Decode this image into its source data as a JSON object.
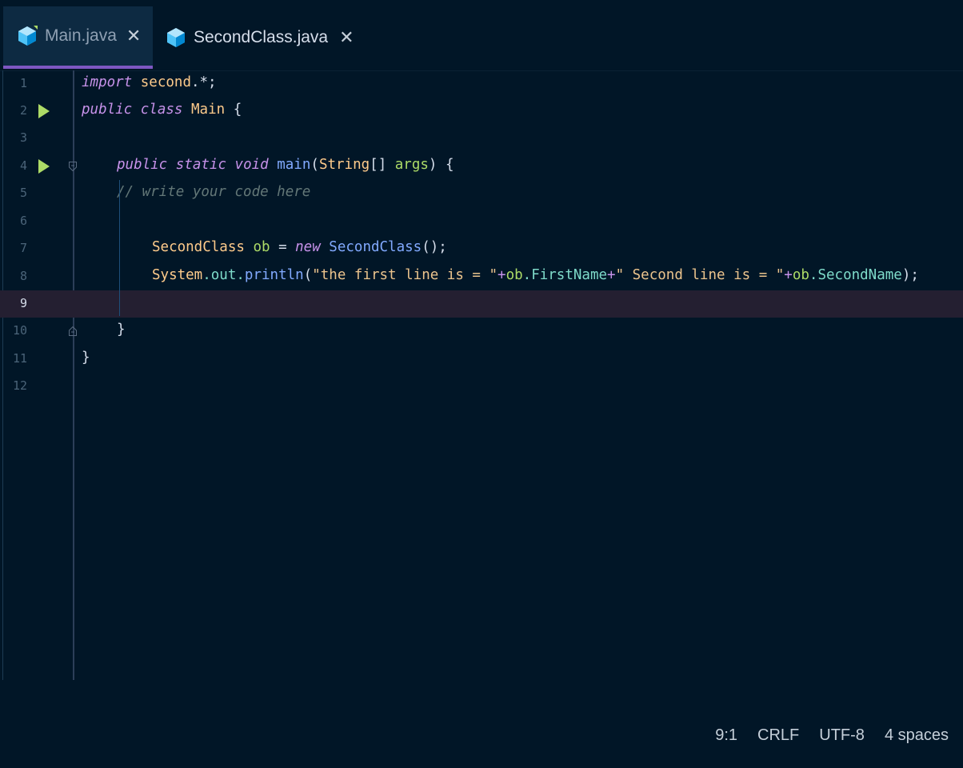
{
  "tabs": [
    {
      "label": "Main.java",
      "active": true,
      "icon": "java-cube-icon"
    },
    {
      "label": "SecondClass.java",
      "active": false,
      "icon": "java-cube-icon"
    }
  ],
  "close_glyph": "✕",
  "editor": {
    "current_line": 9,
    "lines": [
      {
        "n": "1"
      },
      {
        "n": "2"
      },
      {
        "n": "3"
      },
      {
        "n": "4"
      },
      {
        "n": "5"
      },
      {
        "n": "6"
      },
      {
        "n": "7"
      },
      {
        "n": "8"
      },
      {
        "n": "9"
      },
      {
        "n": "10"
      },
      {
        "n": "11"
      },
      {
        "n": "12"
      }
    ],
    "code": {
      "l1": [
        "import",
        " ",
        "second",
        ".*;"
      ],
      "l2": [
        "public",
        " ",
        "class",
        " ",
        "Main",
        " {"
      ],
      "l4": [
        "public",
        " ",
        "static",
        " ",
        "void",
        " ",
        "main",
        "(",
        "String",
        "[] ",
        "args",
        ") {"
      ],
      "l5": [
        "// write your code here"
      ],
      "l7": [
        "SecondClass",
        " ",
        "ob",
        " = ",
        "new",
        " ",
        "SecondClass",
        "();"
      ],
      "l8": [
        "System",
        ".",
        "out",
        ".",
        "println",
        "(",
        "\"the first line is = \"",
        "+",
        "ob",
        ".",
        "FirstName",
        "+",
        "\" Second line is = \"",
        "+",
        "ob",
        ".",
        "SecondName",
        ");"
      ],
      "l10": [
        "}"
      ],
      "l11": [
        "}"
      ]
    }
  },
  "status": {
    "cursor": "9:1",
    "line_ending": "CRLF",
    "encoding": "UTF-8",
    "indent": "4 spaces"
  },
  "colors": {
    "background": "#011627",
    "active_tab": "#0d2a42",
    "tab_underline": "#7e57c2",
    "current_line": "#241f31",
    "run_icon": "#addb67",
    "keyword": "#c792ea",
    "class": "#ffcb8b",
    "function": "#82aaff",
    "string": "#ecc48d",
    "comment": "#637777",
    "property": "#7fdbca",
    "variable": "#addb67"
  }
}
